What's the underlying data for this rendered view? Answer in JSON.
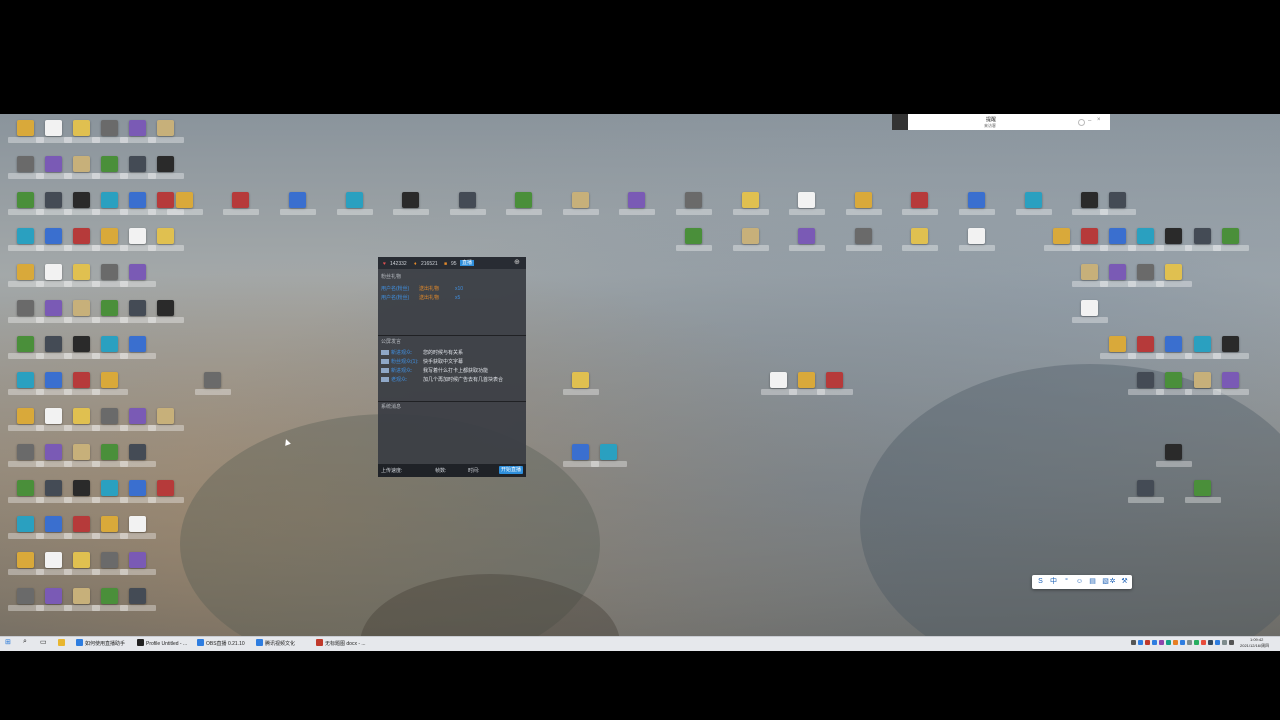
{
  "notification": {
    "title": "提醒",
    "subtitle": "来访客"
  },
  "chat_panel": {
    "stats": [
      "142332",
      "216521",
      "95"
    ],
    "badge": "直播",
    "section1_title": "粉丝礼物",
    "gifts": [
      {
        "user": "用户名(粉丝)",
        "gift": "送出礼物",
        "count": "x10"
      },
      {
        "user": "用户名(粉丝)",
        "gift": "送出礼物",
        "count": "x5"
      }
    ],
    "section2_title": "公屏发言",
    "messages": [
      {
        "user": "新进观众:",
        "text": "您的时候与有关系"
      },
      {
        "user": "粉丝观众(1):",
        "text": "快手获取中文字幕"
      },
      {
        "user": "新进观众:",
        "text": "我写着什么打卡上都获取功能"
      },
      {
        "user": "老观众:",
        "text": "加几个再加时候广告去有几首块表合"
      }
    ],
    "section3_title": "系统消息",
    "footer": {
      "upload_label": "上传速度:",
      "upload_value": "",
      "frames_label": "帧数:",
      "frames_value": "",
      "time_label": "时间:",
      "time_value": "",
      "button": "开始直播"
    }
  },
  "taskbar": {
    "items": [
      {
        "label": "如何使用直播助手",
        "color": "#2e7de0"
      },
      {
        "label": "Profile Untitled - ...",
        "color": "#222222"
      },
      {
        "label": "OBS直播 0.21.10",
        "color": "#2e7de0"
      },
      {
        "label": "腾讯视频文化",
        "color": "#2e7de0"
      },
      {
        "label": "无标题图 docx - ...",
        "color": "#c0392b"
      }
    ],
    "clock_time": "1:09:42",
    "clock_date": "2021/12/16/周四"
  }
}
